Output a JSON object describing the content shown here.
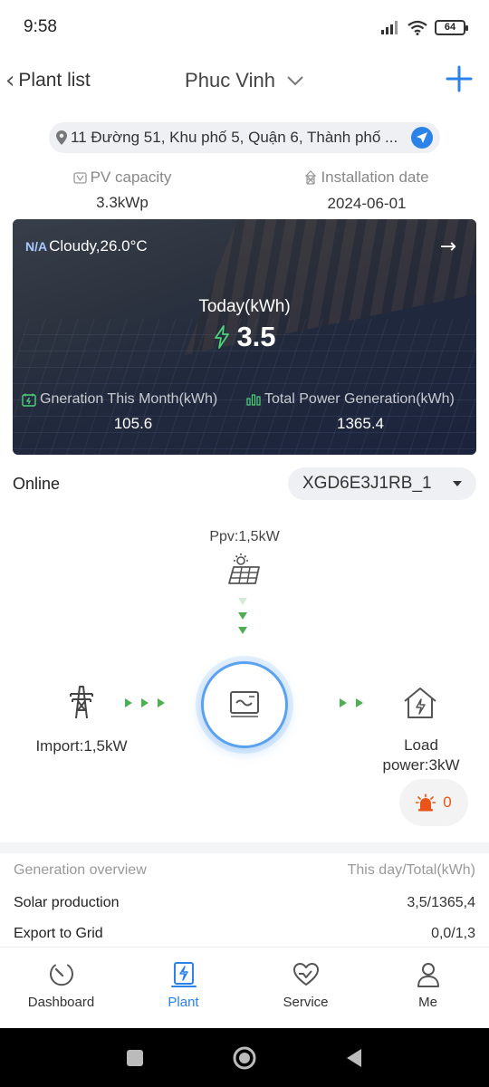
{
  "status_bar": {
    "time": "9:58",
    "battery": "64"
  },
  "nav": {
    "back_label": "Plant list",
    "title": "Phuc Vinh"
  },
  "address": "11 Đường 51, Khu phố 5, Quận 6, Thành phố ...",
  "info": {
    "pv_capacity_label": "PV capacity",
    "pv_capacity_value": "3.3kWp",
    "install_date_label": "Installation date",
    "install_date_value": "2024-06-01"
  },
  "banner": {
    "weather_na": "N/A",
    "weather": "Cloudy,26.0°C",
    "today_label": "Today(kWh)",
    "today_value": "3.5",
    "month_label": "Gneration This Month(kWh)",
    "month_value": "105.6",
    "total_label": "Total Power Generation(kWh)",
    "total_value": "1365.4"
  },
  "device": {
    "status": "Online",
    "selected": "XGD6E3J1RB_1"
  },
  "flow": {
    "ppv": "Ppv:1,5kW",
    "import": "Import:1,5kW",
    "load_line1": "Load",
    "load_line2": "power:3kW",
    "alarm_count": "0"
  },
  "overview": {
    "header_label": "Generation overview",
    "header_value": "This day/Total(kWh)",
    "rows": [
      {
        "label": "Solar production",
        "value": "3,5/1365,4"
      },
      {
        "label": "Export to Grid",
        "value": "0,0/1,3"
      }
    ]
  },
  "tabs": [
    {
      "label": "Dashboard",
      "icon": "dashboard-icon"
    },
    {
      "label": "Plant",
      "icon": "plant-icon"
    },
    {
      "label": "Service",
      "icon": "service-icon"
    },
    {
      "label": "Me",
      "icon": "user-icon"
    }
  ],
  "colors": {
    "accent": "#2b82e8",
    "flow_green": "#4caf50",
    "alarm": "#e8541a"
  }
}
